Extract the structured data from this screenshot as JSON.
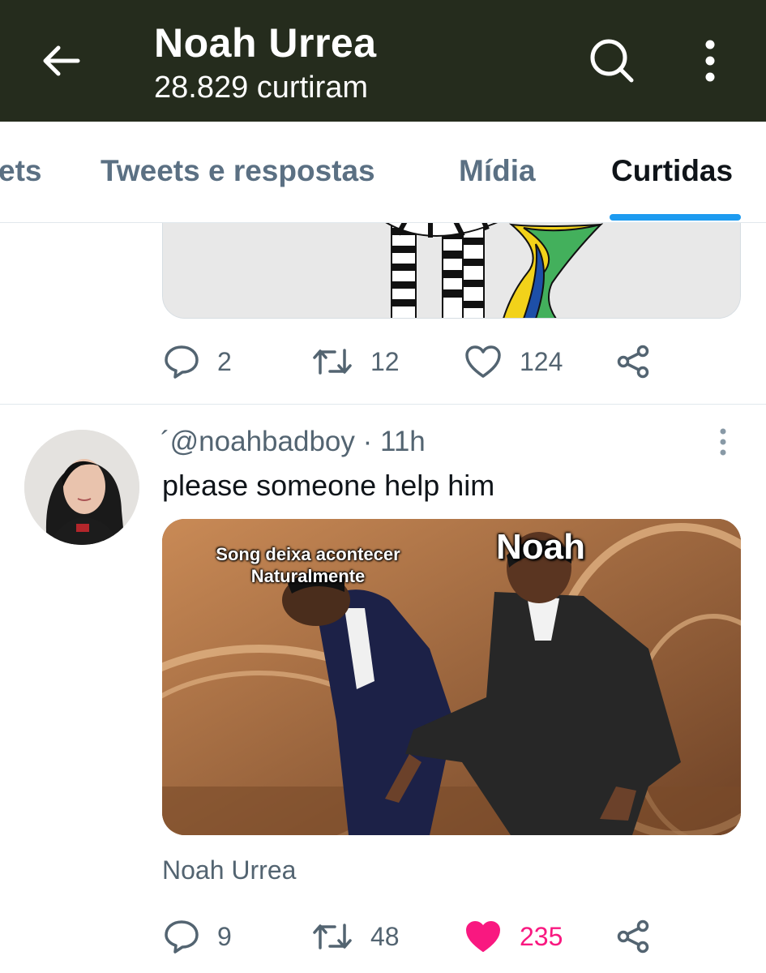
{
  "header": {
    "title": "Noah Urrea",
    "subtitle": "28.829 curtiram",
    "icons": {
      "back": "arrow-left-icon",
      "search": "search-icon",
      "more": "more-vertical-icon"
    }
  },
  "tabs": [
    {
      "label": "Tweets",
      "visible_label": "ets",
      "active": false
    },
    {
      "label": "Tweets e respostas",
      "active": false
    },
    {
      "label": "Mídia",
      "active": false
    },
    {
      "label": "Curtidas",
      "active": true
    }
  ],
  "previous_tweet": {
    "actions": {
      "replies": "2",
      "retweets": "12",
      "likes": "124"
    }
  },
  "tweet": {
    "handle_meta": "´@noahbadboy · 11h",
    "text": "please someone help him",
    "media": {
      "caption_left": "Song deixa acontecer Naturalmente",
      "caption_left_line1": "Song deixa acontecer",
      "caption_left_line2": "Naturalmente",
      "caption_right": "Noah"
    },
    "source": "Noah Urrea",
    "actions": {
      "replies": "9",
      "retweets": "48",
      "likes": "235",
      "liked": true
    }
  },
  "colors": {
    "header_bg": "#252c1d",
    "accent": "#1d9bf0",
    "like": "#f91880",
    "secondary_text": "#536471"
  }
}
